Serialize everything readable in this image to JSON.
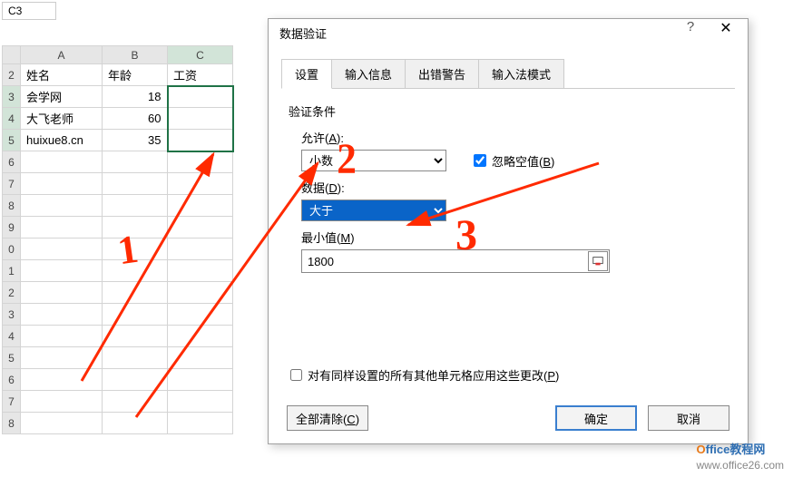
{
  "namebox": "C3",
  "columns": {
    "a": "A",
    "b": "B",
    "c": "C"
  },
  "rows": [
    "2",
    "3",
    "4",
    "5",
    "6",
    "7",
    "8",
    "9",
    "0",
    "1",
    "2",
    "3",
    "4",
    "5",
    "6",
    "7",
    "8"
  ],
  "headers": {
    "name": "姓名",
    "age": "年龄",
    "salary": "工资"
  },
  "data": [
    {
      "name": "会学网",
      "age": "18"
    },
    {
      "name": "大飞老师",
      "age": "60"
    },
    {
      "name": "huixue8.cn",
      "age": "35"
    }
  ],
  "dialog": {
    "title": "数据验证",
    "tabs": {
      "settings": "设置",
      "input": "输入信息",
      "error": "出错警告",
      "ime": "输入法模式"
    },
    "section": "验证条件",
    "allow_label_pre": "允许(",
    "allow_label_key": "A",
    "allow_label_post": "):",
    "allow_value": "小数",
    "ignore_blank_pre": "忽略空值(",
    "ignore_blank_key": "B",
    "ignore_blank_post": ")",
    "data_label_pre": "数据(",
    "data_label_key": "D",
    "data_label_post": "):",
    "data_value": "大于",
    "min_label_pre": "最小值(",
    "min_label_key": "M",
    "min_label_post": ")",
    "min_value": "1800",
    "apply_pre": "对有同样设置的所有其他单元格应用这些更改(",
    "apply_key": "P",
    "apply_post": ")",
    "clear_pre": "全部清除(",
    "clear_key": "C",
    "clear_post": ")",
    "ok": "确定",
    "cancel": "取消"
  },
  "annotations": {
    "one": "1",
    "two": "2",
    "three": "3"
  },
  "watermark": {
    "brand_o": "O",
    "brand_rest": "ffice教程网",
    "url": "www.office26.com"
  }
}
